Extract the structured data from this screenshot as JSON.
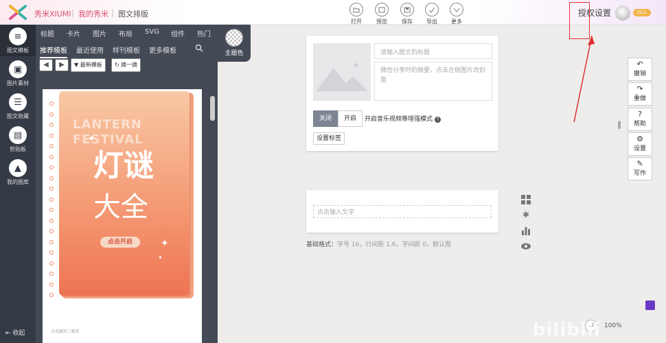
{
  "topbar": {
    "brand": "秀米XIUMI",
    "crumbs": [
      "我的秀米",
      "图文排版"
    ],
    "sep": "|",
    "tools": [
      {
        "label": "打开",
        "icon": "folder-icon"
      },
      {
        "label": "预览",
        "icon": "eye-icon"
      },
      {
        "label": "保存",
        "icon": "save-icon"
      },
      {
        "label": "导出",
        "icon": "check-icon"
      },
      {
        "label": "更多",
        "icon": "chevron-down-icon"
      }
    ],
    "auth": "授权设置",
    "level": "LV.1"
  },
  "rail": {
    "items": [
      "图文模板",
      "图片素材",
      "图文收藏",
      "剪贴板",
      "我的图库"
    ],
    "collapse": "收起"
  },
  "panel": {
    "tabs": [
      "标题",
      "卡片",
      "图片",
      "布局",
      "SVG",
      "组件",
      "热门"
    ],
    "subtabs": [
      "推荐模板",
      "最近使用",
      "样刊模板",
      "更多模板"
    ],
    "newest": "最新模板",
    "switch": "换一换",
    "prev": "◀",
    "next": "▶"
  },
  "theme": {
    "label": "主题色"
  },
  "card": {
    "line1": "LANTERN",
    "line2": "FESTIVAL",
    "title1": "灯谜",
    "title2": "大全",
    "button": "点击开启",
    "footer": "点击翻页 | 翻页"
  },
  "editor": {
    "title_ph": "请输入图文的标题",
    "desc_ph": "微信分享时的摘要，点击左侧图片改封面",
    "off": "关闭",
    "on": "开启",
    "music": "开启音乐视频等增强模式",
    "tag": "设置标签",
    "text_ph": "点击输入文字"
  },
  "basefmt": {
    "label": "基础格式：",
    "value": "字号 16，行间距 1.6，字间距 0，默认图"
  },
  "rightbar": [
    {
      "label": "撤销",
      "icon": "undo-icon",
      "g": "↶"
    },
    {
      "label": "重做",
      "icon": "redo-icon",
      "g": "↷"
    },
    {
      "label": "帮助",
      "icon": "help-icon",
      "g": "?"
    },
    {
      "label": "设置",
      "icon": "gear-icon",
      "g": "⚙"
    },
    {
      "label": "写作",
      "icon": "pen-icon",
      "g": "✎"
    }
  ],
  "zoom": "100%",
  "watermark": "bilibili"
}
